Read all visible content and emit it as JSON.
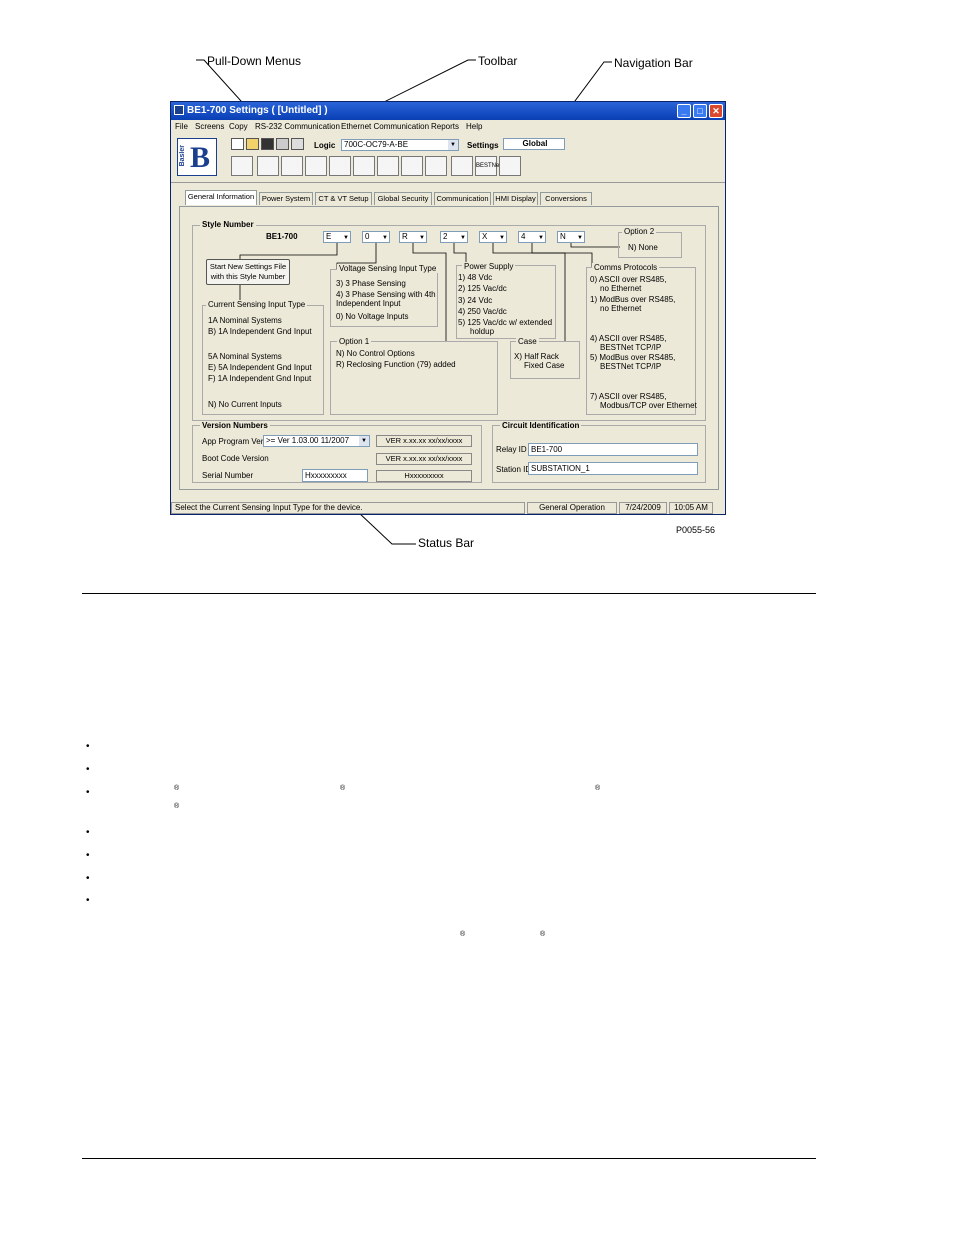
{
  "callouts": {
    "pull_down": "Pull-Down Menus",
    "toolbar": "Toolbar",
    "navigation": "Navigation Bar",
    "status": "Status Bar",
    "figure_id": "P0055-56"
  },
  "window": {
    "title": "BE1-700 Settings   ( [Untitled] )",
    "min": "_",
    "max": "□",
    "close": "✕"
  },
  "menus": [
    "File",
    "Screens",
    "Copy",
    "RS-232 Communication",
    "Ethernet Communication",
    "Reports",
    "Help"
  ],
  "toolbar": {
    "logo_letter": "B",
    "logo_text": "Basler",
    "logic_label": "Logic",
    "logic_value": "700C-OC79-A-BE",
    "settings_label": "Settings",
    "settings_value": "Global",
    "bestnet": "BESTNet"
  },
  "tabs": [
    "General Information",
    "Power System",
    "CT & VT Setup",
    "Global Security",
    "Communication",
    "HMI Display",
    "Conversions"
  ],
  "style_number": {
    "group_label": "Style Number",
    "model": "BE1-700",
    "values": [
      "E",
      "0",
      "R",
      "2",
      "X",
      "4",
      "N"
    ],
    "start_button_line1": "Start New Settings File",
    "start_button_line2": "with this Style Number"
  },
  "option2": {
    "label": "Option 2",
    "items": [
      "N) None"
    ]
  },
  "voltage_sensing": {
    "label": "Voltage Sensing Input Type",
    "items": [
      "3) 3 Phase Sensing",
      "4) 3 Phase Sensing with 4th",
      "Independent Input",
      "0) No Voltage Inputs"
    ]
  },
  "power_supply": {
    "label": "Power Supply",
    "items": [
      "1) 48 Vdc",
      "2) 125  Vac/dc",
      "3) 24 Vdc",
      "4) 250 Vac/dc",
      "5) 125 Vac/dc w/ extended",
      "holdup"
    ]
  },
  "comms": {
    "label": "Comms Protocols",
    "items": [
      "0) ASCII over RS485,",
      "no Ethernet",
      "1) ModBus over RS485,",
      "no Ethernet",
      "4) ASCII over RS485,",
      "BESTNet TCP/IP",
      "5) ModBus over RS485,",
      "BESTNet TCP/IP",
      "7) ASCII over RS485,",
      "Modbus/TCP over Ethernet"
    ]
  },
  "current_sensing": {
    "label": "Current Sensing Input Type",
    "items": [
      "1A Nominal Systems",
      "B) 1A Independent Gnd Input",
      "5A Nominal Systems",
      "E) 5A Independent Gnd Input",
      "F) 1A Independent Gnd Input",
      "N) No Current Inputs"
    ]
  },
  "option1": {
    "label": "Option 1",
    "items": [
      "N) No Control Options",
      "R) Reclosing Function (79) added"
    ]
  },
  "case": {
    "label": "Case",
    "items": [
      "X) Half Rack",
      "Fixed Case"
    ]
  },
  "version": {
    "label": "Version Numbers",
    "app_label": "App Program Ver.",
    "app_value": ">= Ver 1.03.00 11/2007",
    "app_ver": "VER x.xx.xx xx/xx/xxxx",
    "boot_label": "Boot Code Version",
    "boot_ver": "VER x.xx.xx xx/xx/xxxx",
    "serial_label": "Serial Number",
    "serial_value": "Hxxxxxxxxx",
    "serial_ro": "Hxxxxxxxxx"
  },
  "circuit": {
    "label": "Circuit Identification",
    "relay_label": "Relay ID",
    "relay_value": "BE1-700",
    "station_label": "Station ID",
    "station_value": "SUBSTATION_1"
  },
  "status": {
    "message": "Select the Current Sensing Input Type for the device.",
    "mode": "General Operation",
    "date": "7/24/2009",
    "time": "10:05 AM"
  },
  "doc": {
    "bullet": "•",
    "reg": "®"
  }
}
